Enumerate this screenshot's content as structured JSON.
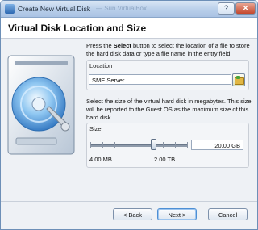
{
  "window": {
    "title": "Create New Virtual Disk",
    "ghost_title": "— Sun VirtualBox",
    "help_label": "?",
    "close_label": "✕"
  },
  "header": {
    "title": "Virtual Disk Location and Size"
  },
  "intro": {
    "before": "Press the ",
    "bold": "Select",
    "after": " button to select the location of a file to store the hard disk data or type a file name in the entry field."
  },
  "location": {
    "label": "Location",
    "value": "SME Server",
    "browse_icon": "folder-browse-icon"
  },
  "size_description": "Select the size of the virtual hard disk in megabytes. This size will be reported to the Guest OS as the maximum size of this hard disk.",
  "size": {
    "label": "Size",
    "value": "20.00 GB",
    "min_label": "4.00 MB",
    "max_label": "2.00 TB",
    "slider_fraction": 0.63
  },
  "buttons": {
    "back": "< Back",
    "next": "Next >",
    "cancel": "Cancel"
  },
  "colors": {
    "accent": "#4e8fd4",
    "titlebar": "#b9cfea",
    "disk_blue": "#3f89d0"
  }
}
